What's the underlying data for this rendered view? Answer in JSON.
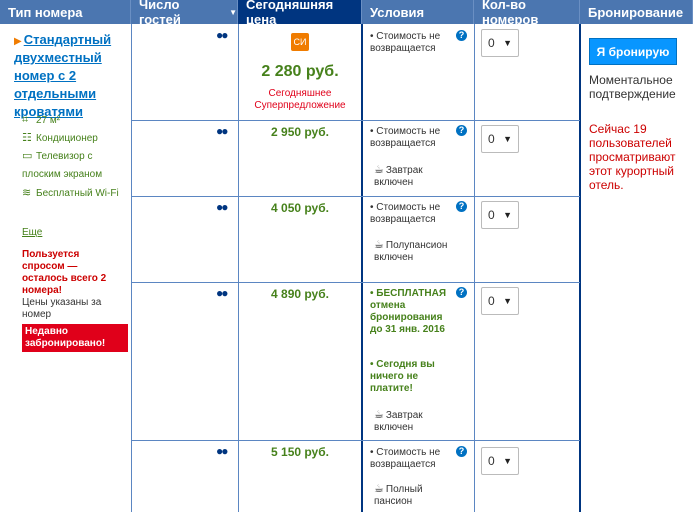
{
  "header": {
    "room_type": "Тип номера",
    "guests": "Число гостей",
    "price": "Сегодняшняя цена",
    "conditions": "Условия",
    "rooms_count": "Кол-во номеров",
    "booking": "Бронирование"
  },
  "room": {
    "name": "Стандартный двухместный номер с 2 отдельными кроватями",
    "facilities": [
      {
        "icon": "area-icon",
        "label": "27 м²"
      },
      {
        "icon": "ac-icon",
        "label": "Кондиционер"
      },
      {
        "icon": "tv-icon",
        "label": "Телевизор с плоским экраном"
      },
      {
        "icon": "wifi-icon",
        "label": "Бесплатный Wi-Fi"
      }
    ],
    "more": "Еще",
    "demand": "Пользуется спросом — осталось всего 2 номера!",
    "prices_note": "Цены указаны за номер",
    "booked_badge": "Недавно забронировано!"
  },
  "offers": [
    {
      "price": "2 280 руб.",
      "deal_icon": "СИ",
      "deal_text": "Сегодняшнее Суперпредложение",
      "conditions": [
        "Стоимость не возвращается"
      ],
      "rooms": "0"
    },
    {
      "price": "2 950 руб.",
      "conditions": [
        "Стоимость не возвращается"
      ],
      "meal": "Завтрак включен",
      "rooms": "0"
    },
    {
      "price": "4 050 руб.",
      "conditions": [
        "Стоимость не возвращается"
      ],
      "meal": "Полупансион включен",
      "rooms": "0"
    },
    {
      "price": "4 890 руб.",
      "free_cancel": "БЕСПЛАТНАЯ отмена бронирования до 31 янв. 2016",
      "pay_later": "Сегодня вы ничего не платите!",
      "meal": "Завтрак включен",
      "rooms": "0"
    },
    {
      "price": "5 150 руб.",
      "conditions": [
        "Стоимость не возвращается"
      ],
      "meal": "Полный пансион",
      "rooms": "0"
    }
  ],
  "booking": {
    "button": "Я бронирую",
    "instant": "Моментальное подтверждение",
    "watchers": "Сейчас 19 пользователей просматривают этот курортный отель."
  },
  "colors": {
    "header": "#4b76b0",
    "header_active": "#003580",
    "price_green": "#46811b",
    "button": "#0896ff"
  }
}
